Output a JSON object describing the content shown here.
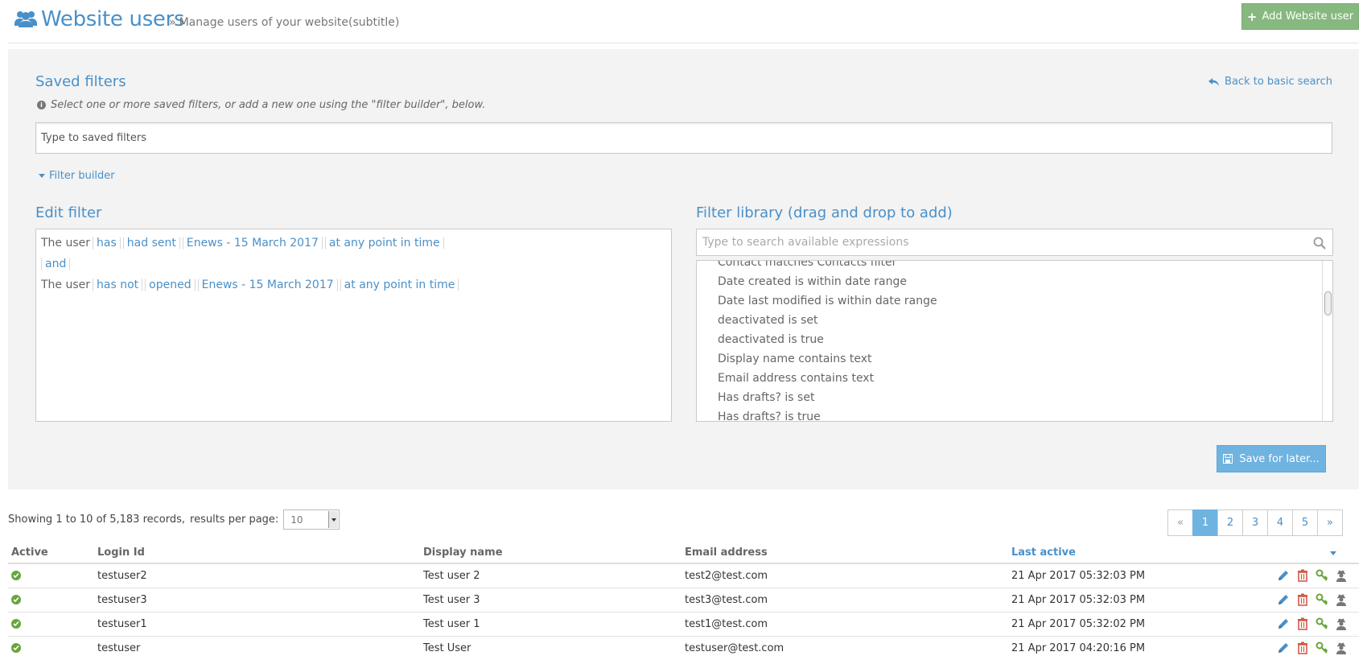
{
  "header": {
    "title": "Website users",
    "subtitle": "Manage users of your website(subtitle)",
    "subtitle_separator": "»",
    "add_button_label": "Add Website user",
    "colors": {
      "title": "#4a90c8",
      "add_button": "#87b87f"
    }
  },
  "saved_filters": {
    "title": "Saved filters",
    "back_link": "Back to basic search",
    "hint": "Select one or more saved filters, or add a new one using the \"filter builder\", below.",
    "input_value": "Type to saved filters"
  },
  "filter_builder": {
    "toggle_label": "Filter builder",
    "edit_title": "Edit filter",
    "lines": [
      {
        "static": "The user",
        "tokens": [
          "has",
          "had sent",
          "Enews - 15 March 2017",
          "at any point in time"
        ]
      },
      {
        "static": "",
        "tokens": [
          "and"
        ]
      },
      {
        "static": "The user",
        "tokens": [
          "has not",
          "opened",
          "Enews - 15 March 2017",
          "at any point in time"
        ]
      }
    ],
    "library_title": "Filter library (drag and drop to add)",
    "library_search_placeholder": "Type to search available expressions",
    "library_items": [
      "Contact matches Contacts filter",
      "Date created is within date range",
      "Date last modified is within date range",
      "deactivated is set",
      "deactivated is true",
      "Display name contains text",
      "Email address contains text",
      "Has drafts? is set",
      "Has drafts? is true"
    ],
    "save_button_label": "Save for later..."
  },
  "results": {
    "showing_text": "Showing 1 to 10 of 5,183 records,",
    "per_page_label": "results per page:",
    "per_page_value": "10",
    "pagination": [
      "«",
      "1",
      "2",
      "3",
      "4",
      "5",
      "»"
    ],
    "active_page": "1",
    "columns": [
      "Active",
      "Login Id",
      "Display name",
      "Email address",
      "Last active"
    ],
    "sorted_column": "Last active",
    "rows": [
      {
        "login": "testuser2",
        "name": "Test user 2",
        "email": "test2@test.com",
        "last_active": "21 Apr 2017 05:32:03 PM"
      },
      {
        "login": "testuser3",
        "name": "Test user 3",
        "email": "test3@test.com",
        "last_active": "21 Apr 2017 05:32:03 PM"
      },
      {
        "login": "testuser1",
        "name": "Test user 1",
        "email": "test1@test.com",
        "last_active": "21 Apr 2017 05:32:02 PM"
      },
      {
        "login": "testuser",
        "name": "Test User",
        "email": "testuser@test.com",
        "last_active": "21 Apr 2017 04:20:16 PM"
      }
    ],
    "row_actions": [
      "pencil-icon",
      "trash-icon",
      "key-icon",
      "user-secret-icon"
    ],
    "colors": {
      "active_check": "#68a53a",
      "edit": "#4a90c8",
      "delete": "#d15b47",
      "key": "#68a53a",
      "impersonate": "#777777"
    }
  }
}
